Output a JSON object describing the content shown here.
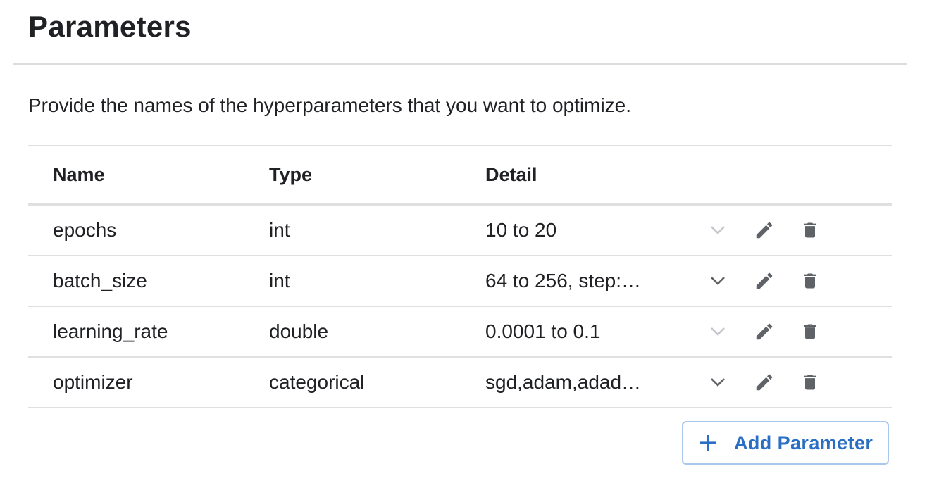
{
  "header": {
    "title": "Parameters"
  },
  "description": "Provide the names of the hyperparameters that you want to optimize.",
  "table": {
    "columns": [
      "Name",
      "Type",
      "Detail"
    ],
    "rows": [
      {
        "name": "epochs",
        "type": "int",
        "detail": "10 to 20",
        "expand_enabled": false
      },
      {
        "name": "batch_size",
        "type": "int",
        "detail": "64 to 256, step:…",
        "expand_enabled": true
      },
      {
        "name": "learning_rate",
        "type": "double",
        "detail": "0.0001 to 0.1",
        "expand_enabled": false
      },
      {
        "name": "optimizer",
        "type": "categorical",
        "detail": "sgd,adam,adad…",
        "expand_enabled": true
      }
    ],
    "row_icons": [
      "chevron-down-icon",
      "pencil-icon",
      "trash-icon"
    ]
  },
  "add_button": {
    "label": "Add Parameter",
    "icon": "plus-icon"
  },
  "colors": {
    "accent": "#1a73e8",
    "icon_active": "#5f6368",
    "icon_disabled": "#bdc1c6",
    "divider": "#e0e0e0"
  }
}
